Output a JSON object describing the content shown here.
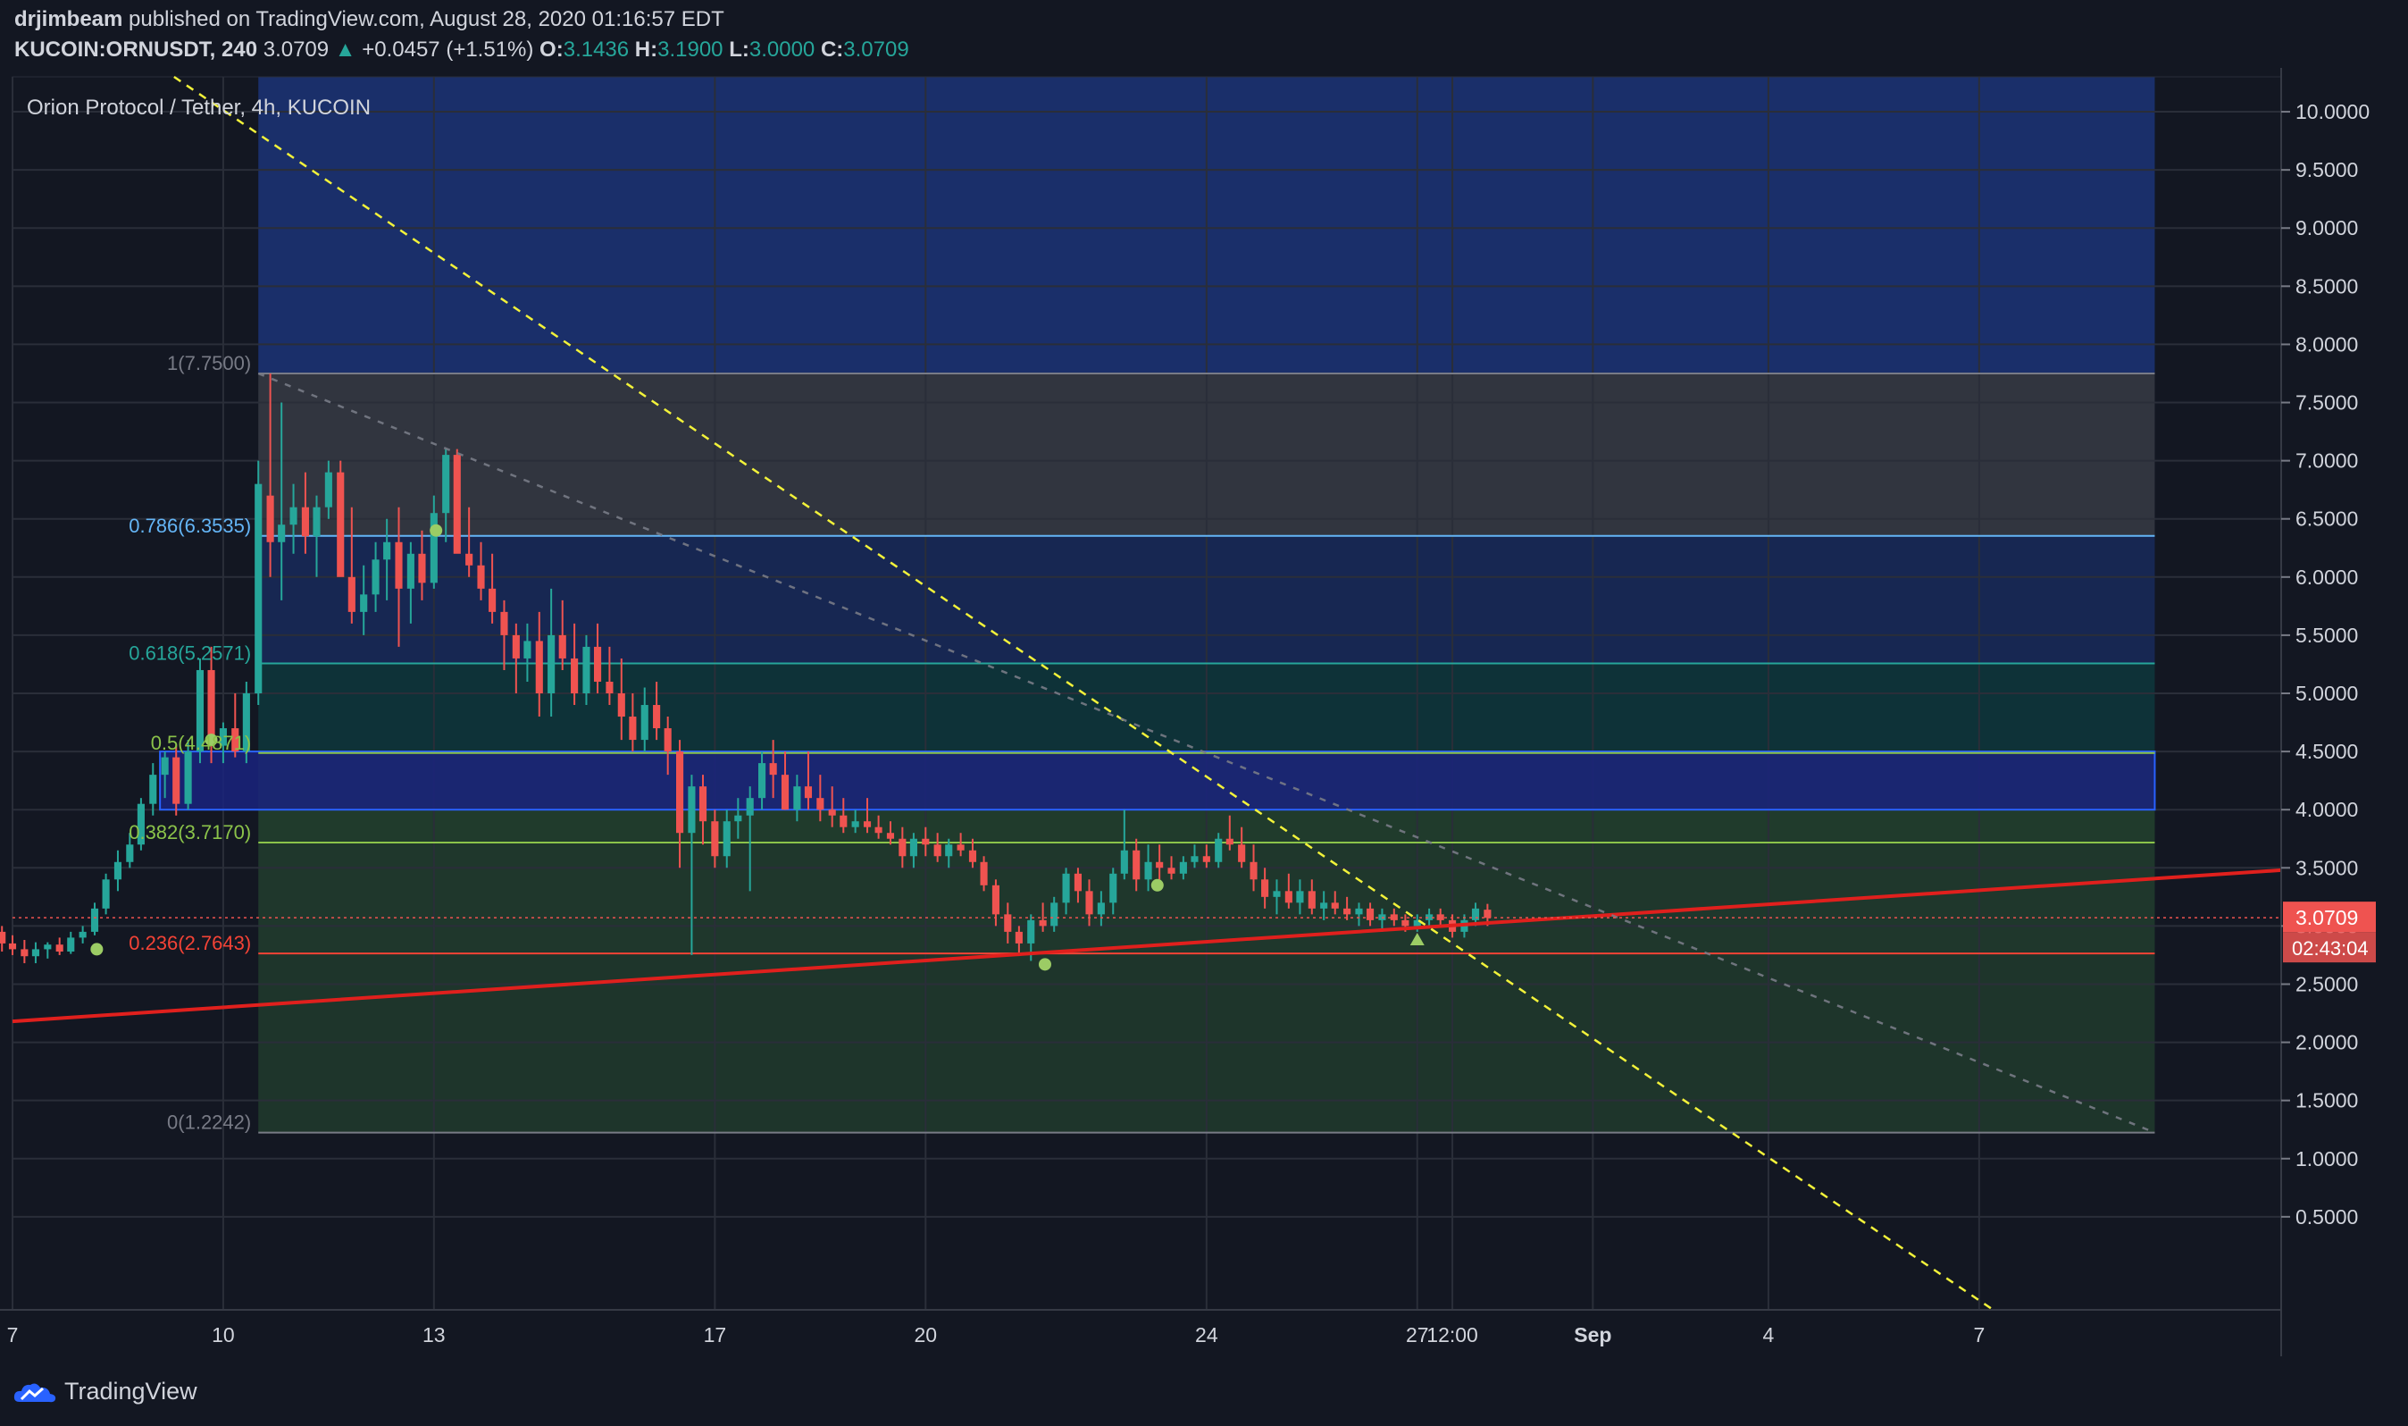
{
  "header": {
    "author": "drjimbeam",
    "published_text": "published on TradingView.com, August 28, 2020 01:16:57 EDT",
    "symbol_interval": "KUCOIN:ORNUSDT, 240",
    "last_price": "3.0709",
    "change": "+0.0457 (+1.51%)",
    "o_label": "O:",
    "o_value": "3.1436",
    "h_label": "H:",
    "h_value": "3.1900",
    "l_label": "L:",
    "l_value": "3.0000",
    "c_label": "C:",
    "c_value": "3.0709"
  },
  "footer": {
    "brand": "TradingView"
  },
  "colors": {
    "background": "#131722",
    "up": "#26a69a",
    "down": "#ef5350",
    "grid": "#2a2e39",
    "trend_red": "#e0201d",
    "trend_yellow": "#f2f23a"
  },
  "chart_data": {
    "type": "candlestick",
    "title": "Orion Protocol / Tether, 4h, KUCOIN",
    "x_ticks": [
      "7",
      "10",
      "13",
      "17",
      "20",
      "24",
      "27",
      "12:00",
      "Sep",
      "4",
      "7"
    ],
    "x_tick_days": [
      7,
      10,
      13,
      17,
      20,
      24,
      27,
      27.5,
      29.5,
      32,
      35
    ],
    "y_ticks": [
      "10.0000",
      "9.5000",
      "9.0000",
      "8.5000",
      "8.0000",
      "7.5000",
      "7.0000",
      "6.5000",
      "6.0000",
      "5.5000",
      "5.0000",
      "4.5000",
      "4.0000",
      "3.5000",
      "3.0000",
      "2.5000",
      "2.0000",
      "1.5000",
      "1.0000",
      "0.5000"
    ],
    "y_tick_values": [
      10,
      9.5,
      9,
      8.5,
      8,
      7.5,
      7,
      6.5,
      6,
      5.5,
      5,
      4.5,
      4,
      3.5,
      3,
      2.5,
      2,
      1.5,
      1,
      0.5
    ],
    "ylim": [
      -0.3,
      10.3
    ],
    "xlim_days": [
      7,
      39.3
    ],
    "fib": {
      "start_day": 10.5,
      "end_day": 37.5,
      "levels": [
        {
          "label": "1(7.7500)",
          "value": 7.75,
          "color": "#787b86"
        },
        {
          "label": "0.786(6.3535)",
          "value": 6.3535,
          "color": "#64b5f6"
        },
        {
          "label": "0.618(5.2571)",
          "value": 5.2571,
          "color": "#26a69a"
        },
        {
          "label": "0.5(4.4871)",
          "value": 4.4871,
          "color": "#8bc34a"
        },
        {
          "label": "0.382(3.7170)",
          "value": 3.717,
          "color": "#8bc34a"
        },
        {
          "label": "0.236(2.7643)",
          "value": 2.7643,
          "color": "#f44336"
        },
        {
          "label": "0(1.2242)",
          "value": 1.2242,
          "color": "#787b86"
        }
      ],
      "extension_top": 10.3
    },
    "zones": [
      {
        "from_day": 9.1,
        "to_day": 37.5,
        "low": 4.0,
        "high": 4.5,
        "color": "#1a237e"
      }
    ],
    "trendlines": [
      {
        "name": "support",
        "x1": 7,
        "y1": 2.18,
        "x2": 39.3,
        "y2": 3.48,
        "color": "#e0201d",
        "dash": false
      },
      {
        "name": "descending",
        "x1": 9.3,
        "y1": 10.3,
        "x2": 35.2,
        "y2": -0.3,
        "color": "#f2f23a",
        "dash": true
      },
      {
        "name": "fib-diagonal",
        "x1": 10.5,
        "y1": 7.75,
        "x2": 37.5,
        "y2": 1.2242,
        "color": "#787b86",
        "dash": true
      }
    ],
    "current_price": {
      "value": 3.0709,
      "label": "3.0709",
      "countdown": "02:43:04"
    },
    "markers": [
      {
        "day": 8.2,
        "value": 2.8,
        "shape": "dot",
        "color": "#9ccc65"
      },
      {
        "day": 9.83,
        "value": 4.6,
        "shape": "dot",
        "color": "#9ccc65"
      },
      {
        "day": 13.03,
        "value": 6.4,
        "shape": "dot",
        "color": "#9ccc65"
      },
      {
        "day": 21.7,
        "value": 2.67,
        "shape": "dot",
        "color": "#9ccc65"
      },
      {
        "day": 23.3,
        "value": 3.35,
        "shape": "dot",
        "color": "#9ccc65"
      },
      {
        "day": 27.0,
        "value": 2.88,
        "shape": "triangle",
        "color": "#9ccc65"
      }
    ],
    "candles": [
      [
        6.85,
        2.95,
        3.0,
        2.78,
        2.85
      ],
      [
        7.0,
        2.85,
        2.92,
        2.75,
        2.8
      ],
      [
        7.17,
        2.8,
        2.88,
        2.68,
        2.74
      ],
      [
        7.33,
        2.74,
        2.86,
        2.68,
        2.8
      ],
      [
        7.5,
        2.8,
        2.86,
        2.72,
        2.84
      ],
      [
        7.67,
        2.84,
        2.9,
        2.75,
        2.78
      ],
      [
        7.83,
        2.78,
        2.95,
        2.76,
        2.9
      ],
      [
        8.0,
        2.9,
        3.0,
        2.85,
        2.95
      ],
      [
        8.17,
        2.95,
        3.2,
        2.92,
        3.15
      ],
      [
        8.33,
        3.15,
        3.45,
        3.1,
        3.4
      ],
      [
        8.5,
        3.4,
        3.65,
        3.3,
        3.55
      ],
      [
        8.67,
        3.55,
        3.8,
        3.5,
        3.7
      ],
      [
        8.83,
        3.7,
        4.1,
        3.65,
        4.05
      ],
      [
        9.0,
        4.05,
        4.4,
        3.95,
        4.3
      ],
      [
        9.17,
        4.3,
        4.5,
        4.1,
        4.45
      ],
      [
        9.33,
        4.45,
        4.55,
        3.95,
        4.05
      ],
      [
        9.5,
        4.05,
        4.6,
        4.0,
        4.5
      ],
      [
        9.67,
        4.5,
        5.3,
        4.4,
        5.2
      ],
      [
        9.83,
        5.2,
        5.4,
        4.4,
        4.55
      ],
      [
        10.0,
        4.55,
        4.75,
        4.4,
        4.7
      ],
      [
        10.17,
        4.7,
        5.0,
        4.45,
        4.5
      ],
      [
        10.33,
        4.5,
        5.1,
        4.4,
        5.0
      ],
      [
        10.5,
        5.0,
        7.0,
        4.9,
        6.8
      ],
      [
        10.67,
        6.7,
        7.75,
        6.0,
        6.3
      ],
      [
        10.83,
        6.3,
        7.5,
        5.8,
        6.45
      ],
      [
        11.0,
        6.45,
        6.8,
        6.2,
        6.6
      ],
      [
        11.17,
        6.6,
        6.9,
        6.2,
        6.35
      ],
      [
        11.33,
        6.35,
        6.7,
        6.0,
        6.6
      ],
      [
        11.5,
        6.6,
        7.0,
        6.5,
        6.9
      ],
      [
        11.67,
        6.9,
        7.0,
        6.2,
        6.0
      ],
      [
        11.83,
        6.0,
        6.6,
        5.6,
        5.7
      ],
      [
        12.0,
        5.7,
        6.1,
        5.5,
        5.85
      ],
      [
        12.17,
        5.85,
        6.3,
        5.7,
        6.15
      ],
      [
        12.33,
        6.15,
        6.5,
        5.8,
        6.3
      ],
      [
        12.5,
        6.3,
        6.6,
        5.4,
        5.9
      ],
      [
        12.67,
        5.9,
        6.3,
        5.6,
        6.2
      ],
      [
        12.83,
        6.2,
        6.4,
        5.8,
        5.95
      ],
      [
        13.0,
        5.95,
        6.7,
        5.9,
        6.55
      ],
      [
        13.17,
        6.55,
        7.1,
        6.3,
        7.05
      ],
      [
        13.33,
        7.05,
        7.1,
        6.3,
        6.2
      ],
      [
        13.5,
        6.2,
        6.6,
        6.0,
        6.1
      ],
      [
        13.67,
        6.1,
        6.3,
        5.8,
        5.9
      ],
      [
        13.83,
        5.9,
        6.2,
        5.6,
        5.7
      ],
      [
        14.0,
        5.7,
        5.8,
        5.2,
        5.5
      ],
      [
        14.17,
        5.5,
        5.6,
        5.0,
        5.3
      ],
      [
        14.33,
        5.3,
        5.6,
        5.1,
        5.45
      ],
      [
        14.5,
        5.45,
        5.7,
        4.8,
        5.0
      ],
      [
        14.67,
        5.0,
        5.9,
        4.8,
        5.5
      ],
      [
        14.83,
        5.5,
        5.8,
        5.2,
        5.3
      ],
      [
        15.0,
        5.3,
        5.6,
        4.9,
        5.0
      ],
      [
        15.17,
        5.0,
        5.5,
        4.9,
        5.4
      ],
      [
        15.33,
        5.4,
        5.6,
        5.0,
        5.1
      ],
      [
        15.5,
        5.1,
        5.4,
        4.9,
        5.0
      ],
      [
        15.67,
        5.0,
        5.3,
        4.6,
        4.8
      ],
      [
        15.83,
        4.8,
        5.0,
        4.5,
        4.6
      ],
      [
        16.0,
        4.6,
        5.05,
        4.5,
        4.9
      ],
      [
        16.17,
        4.9,
        5.1,
        4.6,
        4.7
      ],
      [
        16.33,
        4.7,
        4.8,
        4.3,
        4.5
      ],
      [
        16.5,
        4.5,
        4.6,
        3.5,
        3.8
      ],
      [
        16.67,
        3.8,
        4.3,
        2.75,
        4.2
      ],
      [
        16.83,
        4.2,
        4.3,
        3.7,
        3.9
      ],
      [
        17.0,
        3.9,
        4.0,
        3.5,
        3.6
      ],
      [
        17.17,
        3.6,
        4.0,
        3.5,
        3.9
      ],
      [
        17.33,
        3.9,
        4.1,
        3.75,
        3.95
      ],
      [
        17.5,
        3.95,
        4.2,
        3.3,
        4.1
      ],
      [
        17.67,
        4.1,
        4.5,
        4.0,
        4.4
      ],
      [
        17.83,
        4.4,
        4.6,
        4.1,
        4.3
      ],
      [
        18.0,
        4.3,
        4.5,
        4.0,
        4.0
      ],
      [
        18.17,
        4.0,
        4.3,
        3.9,
        4.2
      ],
      [
        18.33,
        4.2,
        4.5,
        4.0,
        4.1
      ],
      [
        18.5,
        4.1,
        4.3,
        3.9,
        4.0
      ],
      [
        18.67,
        4.0,
        4.2,
        3.85,
        3.95
      ],
      [
        18.83,
        3.95,
        4.1,
        3.8,
        3.85
      ],
      [
        19.0,
        3.85,
        4.0,
        3.8,
        3.9
      ],
      [
        19.17,
        3.9,
        4.1,
        3.8,
        3.85
      ],
      [
        19.33,
        3.85,
        3.95,
        3.75,
        3.8
      ],
      [
        19.5,
        3.8,
        3.9,
        3.7,
        3.75
      ],
      [
        19.67,
        3.75,
        3.85,
        3.5,
        3.6
      ],
      [
        19.83,
        3.6,
        3.8,
        3.5,
        3.75
      ],
      [
        20.0,
        3.75,
        3.85,
        3.6,
        3.7
      ],
      [
        20.17,
        3.7,
        3.8,
        3.55,
        3.6
      ],
      [
        20.33,
        3.6,
        3.75,
        3.5,
        3.7
      ],
      [
        20.5,
        3.7,
        3.8,
        3.6,
        3.65
      ],
      [
        20.67,
        3.65,
        3.75,
        3.5,
        3.55
      ],
      [
        20.83,
        3.55,
        3.6,
        3.3,
        3.35
      ],
      [
        21.0,
        3.35,
        3.4,
        3.0,
        3.1
      ],
      [
        21.17,
        3.1,
        3.2,
        2.85,
        2.95
      ],
      [
        21.33,
        2.95,
        3.0,
        2.75,
        2.85
      ],
      [
        21.5,
        2.85,
        3.1,
        2.7,
        3.05
      ],
      [
        21.67,
        3.05,
        3.2,
        2.95,
        3.0
      ],
      [
        21.83,
        3.0,
        3.25,
        2.95,
        3.2
      ],
      [
        22.0,
        3.2,
        3.5,
        3.1,
        3.45
      ],
      [
        22.17,
        3.45,
        3.5,
        3.2,
        3.3
      ],
      [
        22.33,
        3.3,
        3.4,
        3.0,
        3.1
      ],
      [
        22.5,
        3.1,
        3.3,
        3.0,
        3.2
      ],
      [
        22.67,
        3.2,
        3.5,
        3.1,
        3.45
      ],
      [
        22.83,
        3.45,
        4.0,
        3.4,
        3.65
      ],
      [
        23.0,
        3.65,
        3.75,
        3.3,
        3.4
      ],
      [
        23.17,
        3.4,
        3.7,
        3.3,
        3.55
      ],
      [
        23.33,
        3.55,
        3.7,
        3.4,
        3.5
      ],
      [
        23.5,
        3.5,
        3.6,
        3.4,
        3.45
      ],
      [
        23.67,
        3.45,
        3.6,
        3.4,
        3.55
      ],
      [
        23.83,
        3.55,
        3.7,
        3.5,
        3.6
      ],
      [
        24.0,
        3.6,
        3.7,
        3.5,
        3.55
      ],
      [
        24.17,
        3.55,
        3.8,
        3.5,
        3.75
      ],
      [
        24.33,
        3.75,
        3.95,
        3.65,
        3.7
      ],
      [
        24.5,
        3.7,
        3.85,
        3.5,
        3.55
      ],
      [
        24.67,
        3.55,
        3.7,
        3.3,
        3.4
      ],
      [
        24.83,
        3.4,
        3.5,
        3.15,
        3.25
      ],
      [
        25.0,
        3.25,
        3.4,
        3.1,
        3.3
      ],
      [
        25.17,
        3.3,
        3.45,
        3.15,
        3.2
      ],
      [
        25.33,
        3.2,
        3.4,
        3.1,
        3.3
      ],
      [
        25.5,
        3.3,
        3.4,
        3.1,
        3.15
      ],
      [
        25.67,
        3.15,
        3.3,
        3.05,
        3.2
      ],
      [
        25.83,
        3.2,
        3.3,
        3.1,
        3.15
      ],
      [
        26.0,
        3.15,
        3.25,
        3.05,
        3.1
      ],
      [
        26.17,
        3.1,
        3.2,
        3.0,
        3.15
      ],
      [
        26.33,
        3.15,
        3.2,
        3.0,
        3.05
      ],
      [
        26.5,
        3.05,
        3.15,
        2.95,
        3.1
      ],
      [
        26.67,
        3.1,
        3.15,
        3.0,
        3.05
      ],
      [
        26.83,
        3.05,
        3.1,
        2.95,
        3.0
      ],
      [
        27.0,
        3.0,
        3.1,
        2.95,
        3.05
      ],
      [
        27.17,
        3.05,
        3.15,
        3.0,
        3.1
      ],
      [
        27.33,
        3.1,
        3.15,
        3.0,
        3.05
      ],
      [
        27.5,
        3.05,
        3.1,
        2.9,
        2.95
      ],
      [
        27.67,
        2.95,
        3.1,
        2.9,
        3.05
      ],
      [
        27.83,
        3.05,
        3.2,
        3.0,
        3.15
      ],
      [
        28.0,
        3.14,
        3.19,
        3.0,
        3.07
      ]
    ]
  }
}
